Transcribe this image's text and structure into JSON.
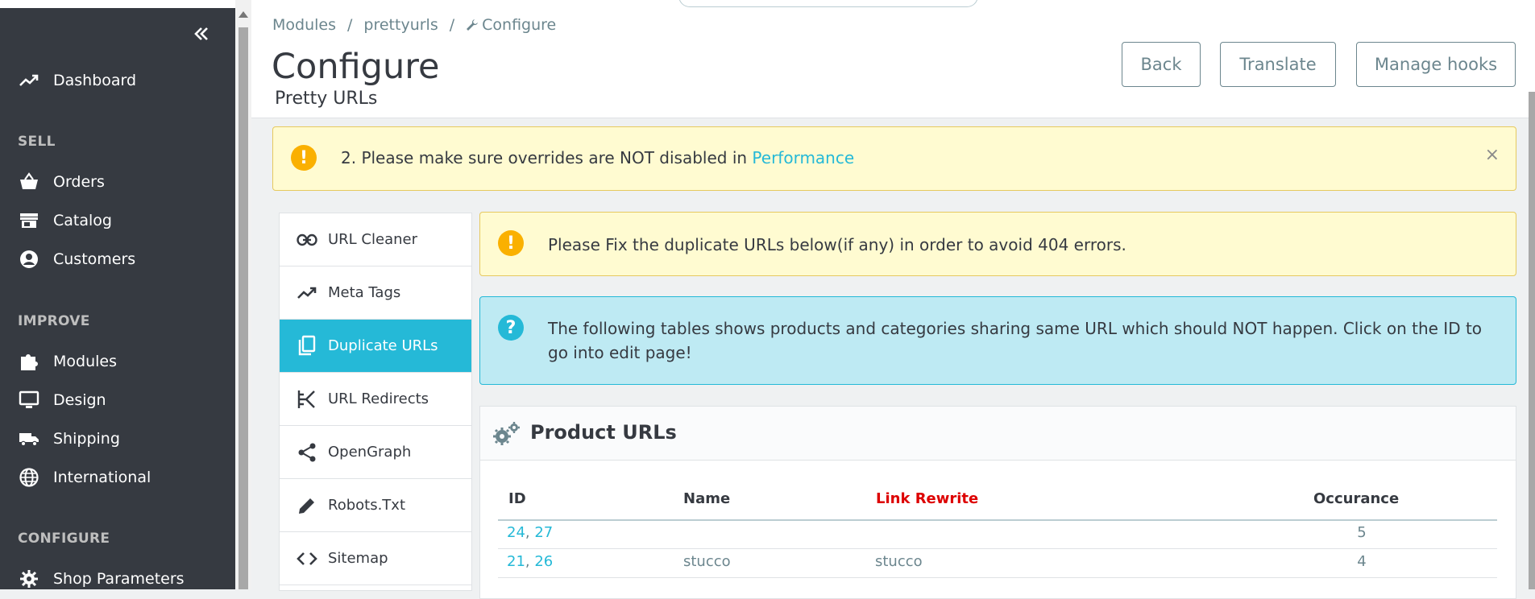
{
  "breadcrumb": {
    "items": [
      "Modules",
      "prettyurls",
      "Configure"
    ],
    "separator": "/"
  },
  "page": {
    "title": "Configure",
    "subtitle": "Pretty URLs"
  },
  "toolbar": {
    "back_label": "Back",
    "translate_label": "Translate",
    "manage_hooks_label": "Manage hooks"
  },
  "sidebar": {
    "dashboard": "Dashboard",
    "sections": {
      "sell": "SELL",
      "improve": "IMPROVE",
      "configure": "CONFIGURE"
    },
    "sell_items": [
      "Orders",
      "Catalog",
      "Customers"
    ],
    "improve_items": [
      "Modules",
      "Design",
      "Shipping",
      "International"
    ],
    "configure_items": [
      "Shop Parameters"
    ]
  },
  "alerts": {
    "overrides": {
      "text": "2. Please make sure overrides are NOT disabled in ",
      "link": "Performance",
      "close": "×"
    },
    "duplicates": {
      "text": "Please Fix the duplicate URLs below(if any) in order to avoid 404 errors."
    },
    "info": {
      "text": "The following tables shows products and categories sharing same URL which should NOT happen. Click on the ID to go into edit page!"
    }
  },
  "tabs": [
    "URL Cleaner",
    "Meta Tags",
    "Duplicate URLs",
    "URL Redirects",
    "OpenGraph",
    "Robots.Txt",
    "Sitemap"
  ],
  "product_urls": {
    "title": "Product URLs",
    "columns": [
      "ID",
      "Name",
      "Link Rewrite",
      "Occurance"
    ],
    "rows": [
      {
        "ids": [
          "24",
          "27"
        ],
        "name": "",
        "link_rewrite": "",
        "occurance": "5"
      },
      {
        "ids": [
          "21",
          "26"
        ],
        "name": "stucco",
        "link_rewrite": "stucco",
        "occurance": "4"
      }
    ]
  },
  "colors": {
    "sidebar_bg": "#363a41",
    "accent": "#25b9d7",
    "warning": "#fab000",
    "danger_text": "#dd0000"
  }
}
